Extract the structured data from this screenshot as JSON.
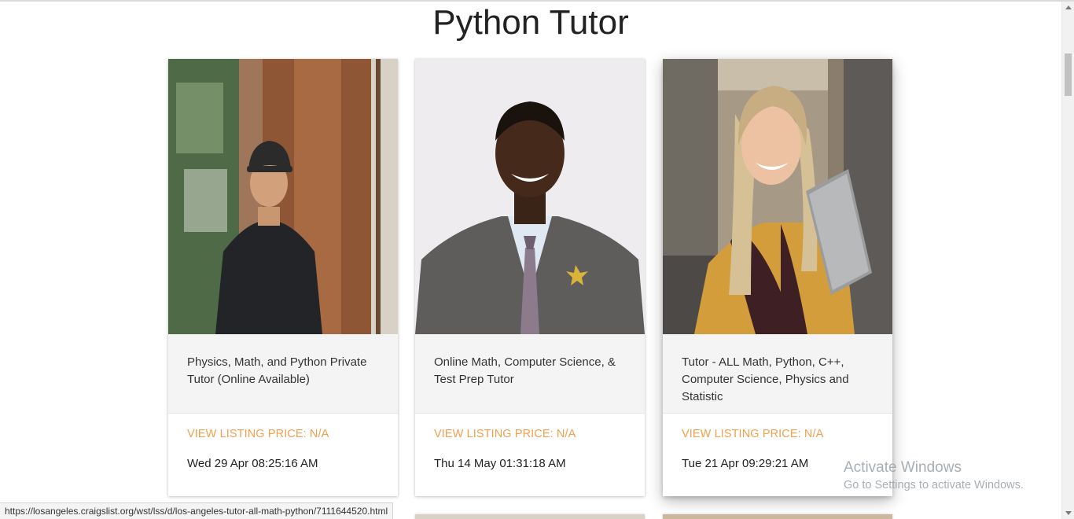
{
  "page": {
    "title": "Python Tutor"
  },
  "cards": [
    {
      "description": "Physics, Math, and Python Private Tutor (Online Available)",
      "link_label": "VIEW LISTING PRICE: N/A",
      "date": "Wed 29 Apr 08:25:16 AM"
    },
    {
      "description": "Online Math, Computer Science, & Test Prep Tutor",
      "link_label": "VIEW LISTING PRICE: N/A",
      "date": "Thu 14 May 01:31:18 AM"
    },
    {
      "description": "Tutor - ALL Math, Python, C++, Computer Science, Physics and Statistic",
      "link_label": "VIEW LISTING PRICE: N/A",
      "date": "Tue 21 Apr 09:29:21 AM"
    }
  ],
  "status_bar": {
    "url": "https://losangeles.craigslist.org/wst/lss/d/los-angeles-tutor-all-math-python/7111644520.html"
  },
  "watermark": {
    "title": "Activate Windows",
    "subtitle": "Go to Settings to activate Windows."
  },
  "colors": {
    "accent": "#f0a050",
    "description_bg": "#f4f4f4",
    "text": "#222222"
  }
}
